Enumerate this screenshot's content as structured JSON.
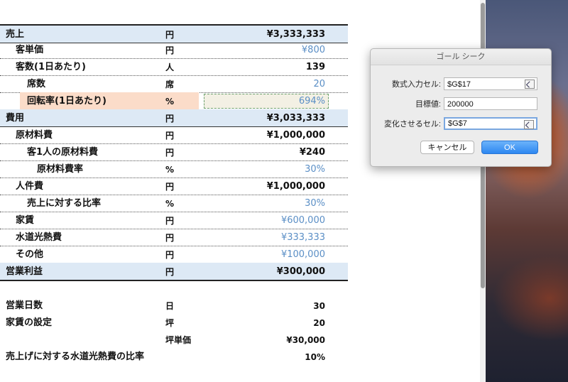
{
  "sheet": {
    "rows": [
      {
        "label": "売上",
        "unit": "円",
        "value": "¥3,333,333"
      },
      {
        "label": "客単価",
        "unit": "円",
        "value": "¥800"
      },
      {
        "label": "客数(1日あたり)",
        "unit": "人",
        "value": "139"
      },
      {
        "label": "席数",
        "unit": "席",
        "value": "20"
      },
      {
        "label": "回転率(1日あたり)",
        "unit": "%",
        "value": "694%"
      },
      {
        "label": "費用",
        "unit": "円",
        "value": "¥3,033,333"
      },
      {
        "label": "原材料費",
        "unit": "円",
        "value": "¥1,000,000"
      },
      {
        "label": "客1人の原材料費",
        "unit": "円",
        "value": "¥240"
      },
      {
        "label": "原材料費率",
        "unit": "%",
        "value": "30%"
      },
      {
        "label": "人件費",
        "unit": "円",
        "value": "¥1,000,000"
      },
      {
        "label": "売上に対する比率",
        "unit": "%",
        "value": "30%"
      },
      {
        "label": "家賃",
        "unit": "円",
        "value": "¥600,000"
      },
      {
        "label": "水道光熱費",
        "unit": "円",
        "value": "¥333,333"
      },
      {
        "label": "その他",
        "unit": "円",
        "value": "¥100,000"
      },
      {
        "label": "営業利益",
        "unit": "円",
        "value": "¥300,000"
      }
    ],
    "extra": [
      {
        "label": "営業日数",
        "unit": "日",
        "value": "30"
      },
      {
        "label": "家賃の設定",
        "unit": "坪",
        "value": "20"
      },
      {
        "label": "",
        "unit": "坪単価",
        "value": "¥30,000"
      },
      {
        "label": "売上げに対する水道光熱費の比率",
        "unit": "",
        "value": "10%"
      }
    ]
  },
  "dialog": {
    "title": "ゴール シーク",
    "set_cell_label": "数式入力セル:",
    "set_cell_value": "$G$17",
    "to_value_label": "目標値:",
    "to_value_value": "200000",
    "changing_cell_label": "変化させるセル:",
    "changing_cell_value": "$G$7",
    "cancel_label": "キャンセル",
    "ok_label": "OK"
  },
  "colors": {
    "header_fill": "#dde9f5",
    "highlight_fill": "#fbdcc9",
    "input_value_blue": "#5b8fc6",
    "ok_button": "#2d87f1"
  }
}
